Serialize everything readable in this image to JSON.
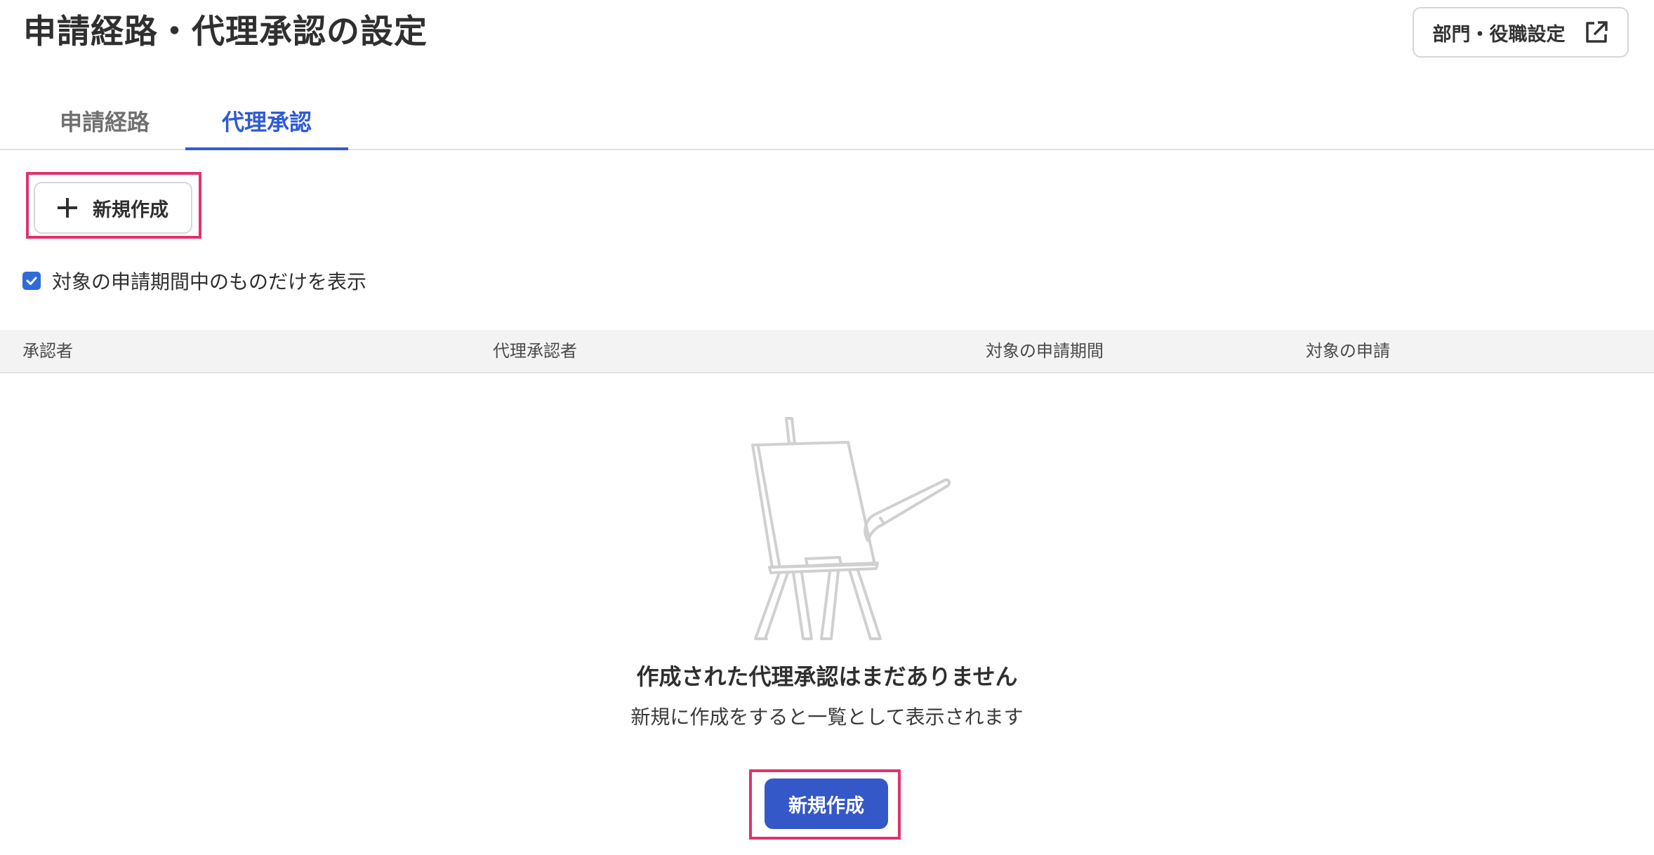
{
  "header": {
    "title": "申請経路・代理承認の設定",
    "dept_role_button_label": "部門・役職設定",
    "dept_role_button_icon": "external-link-icon"
  },
  "tabs": [
    {
      "label": "申請経路",
      "active": false
    },
    {
      "label": "代理承認",
      "active": true
    }
  ],
  "toolbar": {
    "new_button_label": "新規作成",
    "new_button_icon": "plus-icon"
  },
  "filter": {
    "checkbox_checked": true,
    "label": "対象の申請期間中のものだけを表示"
  },
  "table": {
    "columns": [
      "承認者",
      "代理承認者",
      "対象の申請期間",
      "対象の申請"
    ]
  },
  "empty_state": {
    "illustration": "easel-icon",
    "title": "作成された代理承認はまだありません",
    "subtitle": "新規に作成をすると一覧として表示されます",
    "button_label": "新規作成"
  },
  "colors": {
    "accent": "#2f5bd4",
    "primary_button": "#3558c8",
    "highlight": "#e0336b",
    "header_bg": "#f4f3f3"
  }
}
